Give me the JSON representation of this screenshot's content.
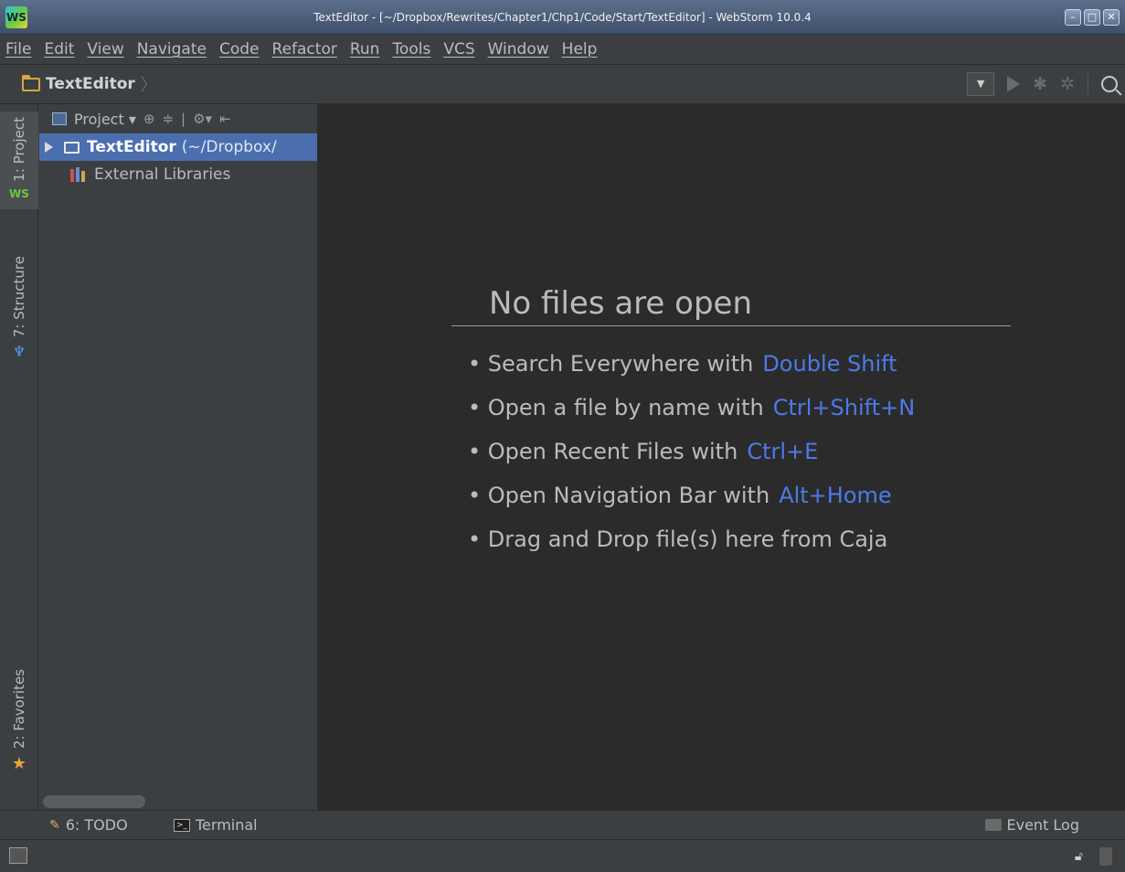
{
  "window": {
    "title": "TextEditor - [~/Dropbox/Rewrites/Chapter1/Chp1/Code/Start/TextEditor] - WebStorm 10.0.4",
    "app_icon": "WS",
    "controls": [
      "minimize",
      "maximize",
      "close"
    ]
  },
  "menu": [
    "File",
    "Edit",
    "View",
    "Navigate",
    "Code",
    "Refactor",
    "Run",
    "Tools",
    "VCS",
    "Window",
    "Help"
  ],
  "navbar": {
    "breadcrumb": "TextEditor",
    "icons": [
      "run-config-dropdown",
      "run-icon",
      "debug-icon",
      "coverage-icon",
      "search-icon"
    ]
  },
  "left_strip": {
    "project": "1: Project",
    "ws_badge": "WS",
    "structure": "7: Structure",
    "favorites": "2: Favorites"
  },
  "project_panel": {
    "header": "Project",
    "tree": [
      {
        "label": "TextEditor",
        "path": "(~/Dropbox/",
        "selected": true
      },
      {
        "label": "External Libraries",
        "selected": false
      }
    ]
  },
  "editor": {
    "empty_title": "No files are open",
    "hints": [
      {
        "text": "• Search Everywhere with",
        "shortcut": "Double Shift"
      },
      {
        "text": "• Open a file by name with",
        "shortcut": "Ctrl+Shift+N"
      },
      {
        "text": "• Open Recent Files with",
        "shortcut": "Ctrl+E"
      },
      {
        "text": "• Open Navigation Bar with",
        "shortcut": "Alt+Home"
      },
      {
        "text": "• Drag and Drop file(s) here from Caja",
        "shortcut": ""
      }
    ]
  },
  "bottom_tools": {
    "todo": "6: TODO",
    "terminal": "Terminal",
    "event_log": "Event Log"
  },
  "colors": {
    "accent": "#4d7ae8",
    "selection": "#4b6eaf",
    "editor_bg": "#2b2b2b",
    "panel_bg": "#3c3f41"
  }
}
